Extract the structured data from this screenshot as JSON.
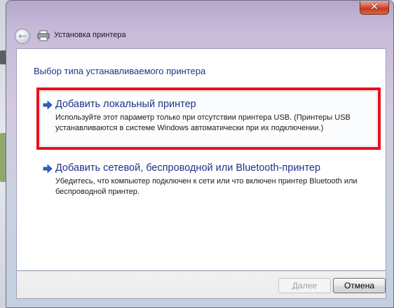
{
  "window": {
    "title": "Установка принтера",
    "close_glyph": "✕"
  },
  "main": {
    "heading": "Выбор типа устанавливаемого принтера",
    "options": [
      {
        "label": "Добавить локальный принтер",
        "description": "Используйте этот параметр только при отсутствии принтера USB. (Принтеры USB устанавливаются в системе Windows автоматически при их подключении.)"
      },
      {
        "label": "Добавить сетевой, беспроводной или Bluetooth-принтер",
        "description": "Убедитесь, что компьютер подключен к сети или что включен принтер Bluetooth или беспроводной принтер."
      }
    ]
  },
  "footer": {
    "next_label": "Далее",
    "cancel_label": "Отмена"
  },
  "icons": {
    "back": "arrow-left-icon",
    "printer": "printer-icon",
    "option_arrow": "arrow-right-icon"
  },
  "colors": {
    "accent": "#1e3287",
    "highlight_border": "#e8101a",
    "close_button": "#c23a20"
  }
}
